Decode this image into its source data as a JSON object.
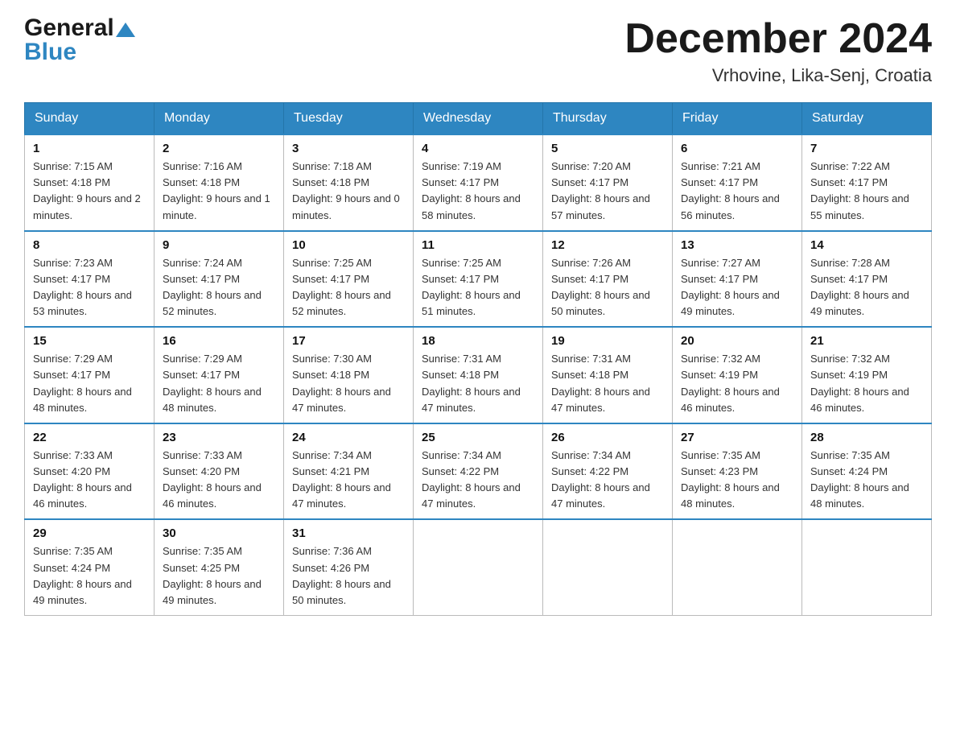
{
  "header": {
    "logo_general": "General",
    "logo_blue": "Blue",
    "month_title": "December 2024",
    "location": "Vrhovine, Lika-Senj, Croatia"
  },
  "days_of_week": [
    "Sunday",
    "Monday",
    "Tuesday",
    "Wednesday",
    "Thursday",
    "Friday",
    "Saturday"
  ],
  "weeks": [
    [
      {
        "day": "1",
        "sunrise": "7:15 AM",
        "sunset": "4:18 PM",
        "daylight": "9 hours and 2 minutes."
      },
      {
        "day": "2",
        "sunrise": "7:16 AM",
        "sunset": "4:18 PM",
        "daylight": "9 hours and 1 minute."
      },
      {
        "day": "3",
        "sunrise": "7:18 AM",
        "sunset": "4:18 PM",
        "daylight": "9 hours and 0 minutes."
      },
      {
        "day": "4",
        "sunrise": "7:19 AM",
        "sunset": "4:17 PM",
        "daylight": "8 hours and 58 minutes."
      },
      {
        "day": "5",
        "sunrise": "7:20 AM",
        "sunset": "4:17 PM",
        "daylight": "8 hours and 57 minutes."
      },
      {
        "day": "6",
        "sunrise": "7:21 AM",
        "sunset": "4:17 PM",
        "daylight": "8 hours and 56 minutes."
      },
      {
        "day": "7",
        "sunrise": "7:22 AM",
        "sunset": "4:17 PM",
        "daylight": "8 hours and 55 minutes."
      }
    ],
    [
      {
        "day": "8",
        "sunrise": "7:23 AM",
        "sunset": "4:17 PM",
        "daylight": "8 hours and 53 minutes."
      },
      {
        "day": "9",
        "sunrise": "7:24 AM",
        "sunset": "4:17 PM",
        "daylight": "8 hours and 52 minutes."
      },
      {
        "day": "10",
        "sunrise": "7:25 AM",
        "sunset": "4:17 PM",
        "daylight": "8 hours and 52 minutes."
      },
      {
        "day": "11",
        "sunrise": "7:25 AM",
        "sunset": "4:17 PM",
        "daylight": "8 hours and 51 minutes."
      },
      {
        "day": "12",
        "sunrise": "7:26 AM",
        "sunset": "4:17 PM",
        "daylight": "8 hours and 50 minutes."
      },
      {
        "day": "13",
        "sunrise": "7:27 AM",
        "sunset": "4:17 PM",
        "daylight": "8 hours and 49 minutes."
      },
      {
        "day": "14",
        "sunrise": "7:28 AM",
        "sunset": "4:17 PM",
        "daylight": "8 hours and 49 minutes."
      }
    ],
    [
      {
        "day": "15",
        "sunrise": "7:29 AM",
        "sunset": "4:17 PM",
        "daylight": "8 hours and 48 minutes."
      },
      {
        "day": "16",
        "sunrise": "7:29 AM",
        "sunset": "4:17 PM",
        "daylight": "8 hours and 48 minutes."
      },
      {
        "day": "17",
        "sunrise": "7:30 AM",
        "sunset": "4:18 PM",
        "daylight": "8 hours and 47 minutes."
      },
      {
        "day": "18",
        "sunrise": "7:31 AM",
        "sunset": "4:18 PM",
        "daylight": "8 hours and 47 minutes."
      },
      {
        "day": "19",
        "sunrise": "7:31 AM",
        "sunset": "4:18 PM",
        "daylight": "8 hours and 47 minutes."
      },
      {
        "day": "20",
        "sunrise": "7:32 AM",
        "sunset": "4:19 PM",
        "daylight": "8 hours and 46 minutes."
      },
      {
        "day": "21",
        "sunrise": "7:32 AM",
        "sunset": "4:19 PM",
        "daylight": "8 hours and 46 minutes."
      }
    ],
    [
      {
        "day": "22",
        "sunrise": "7:33 AM",
        "sunset": "4:20 PM",
        "daylight": "8 hours and 46 minutes."
      },
      {
        "day": "23",
        "sunrise": "7:33 AM",
        "sunset": "4:20 PM",
        "daylight": "8 hours and 46 minutes."
      },
      {
        "day": "24",
        "sunrise": "7:34 AM",
        "sunset": "4:21 PM",
        "daylight": "8 hours and 47 minutes."
      },
      {
        "day": "25",
        "sunrise": "7:34 AM",
        "sunset": "4:22 PM",
        "daylight": "8 hours and 47 minutes."
      },
      {
        "day": "26",
        "sunrise": "7:34 AM",
        "sunset": "4:22 PM",
        "daylight": "8 hours and 47 minutes."
      },
      {
        "day": "27",
        "sunrise": "7:35 AM",
        "sunset": "4:23 PM",
        "daylight": "8 hours and 48 minutes."
      },
      {
        "day": "28",
        "sunrise": "7:35 AM",
        "sunset": "4:24 PM",
        "daylight": "8 hours and 48 minutes."
      }
    ],
    [
      {
        "day": "29",
        "sunrise": "7:35 AM",
        "sunset": "4:24 PM",
        "daylight": "8 hours and 49 minutes."
      },
      {
        "day": "30",
        "sunrise": "7:35 AM",
        "sunset": "4:25 PM",
        "daylight": "8 hours and 49 minutes."
      },
      {
        "day": "31",
        "sunrise": "7:36 AM",
        "sunset": "4:26 PM",
        "daylight": "8 hours and 50 minutes."
      },
      null,
      null,
      null,
      null
    ]
  ]
}
